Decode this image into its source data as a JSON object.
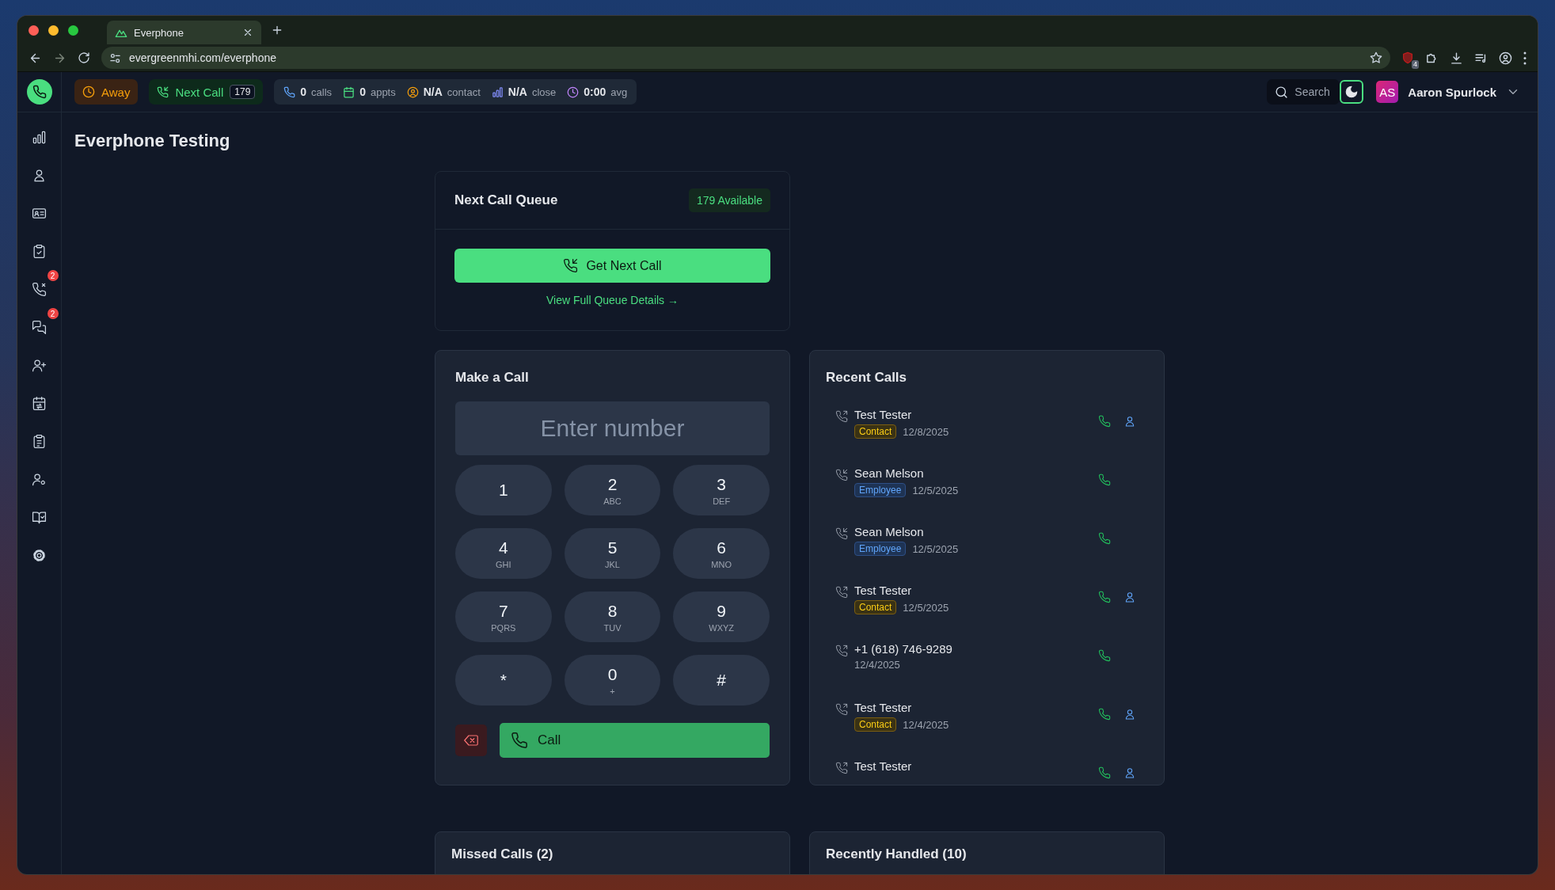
{
  "browser": {
    "tab_title": "Everphone",
    "url": "evergreenmhi.com/everphone",
    "extension_badge": "4"
  },
  "topbar": {
    "status": "Away",
    "next_call": {
      "label": "Next Call",
      "count": "179"
    },
    "stats": [
      {
        "kind": "calls",
        "value": "0",
        "label": "calls"
      },
      {
        "kind": "appts",
        "value": "0",
        "label": "appts"
      },
      {
        "kind": "contact",
        "value": "N/A",
        "label": "contact"
      },
      {
        "kind": "close",
        "value": "N/A",
        "label": "close"
      },
      {
        "kind": "avg",
        "value": "0:00",
        "label": "avg"
      }
    ],
    "search": {
      "placeholder": "Search"
    },
    "user": {
      "initials": "AS",
      "name": "Aaron Spurlock"
    }
  },
  "sidebar": {
    "items": [
      {
        "kind": "stats"
      },
      {
        "kind": "user"
      },
      {
        "kind": "card"
      },
      {
        "kind": "tasks"
      },
      {
        "kind": "missed",
        "badge": "2"
      },
      {
        "kind": "messages",
        "badge": "2"
      },
      {
        "kind": "add-user"
      },
      {
        "kind": "schedule"
      },
      {
        "kind": "list"
      },
      {
        "kind": "user-settings"
      },
      {
        "kind": "book"
      },
      {
        "kind": "settings"
      }
    ]
  },
  "page_title": "Everphone Testing",
  "queue": {
    "title": "Next Call Queue",
    "available": "179 Available",
    "button": "Get Next Call",
    "link": "View Full Queue Details →"
  },
  "dialer": {
    "title": "Make a Call",
    "placeholder": "Enter number",
    "keys": [
      {
        "digit": "1"
      },
      {
        "digit": "2",
        "letters": "ABC"
      },
      {
        "digit": "3",
        "letters": "DEF"
      },
      {
        "digit": "4",
        "letters": "GHI"
      },
      {
        "digit": "5",
        "letters": "JKL"
      },
      {
        "digit": "6",
        "letters": "MNO"
      },
      {
        "digit": "7",
        "letters": "PQRS"
      },
      {
        "digit": "8",
        "letters": "TUV"
      },
      {
        "digit": "9",
        "letters": "WXYZ"
      },
      {
        "digit": "*"
      },
      {
        "digit": "0",
        "letters": "+"
      },
      {
        "digit": "#"
      }
    ],
    "call_button": "Call"
  },
  "recent": {
    "title": "Recent Calls",
    "calls": [
      {
        "name": "Test Tester",
        "kind": "outgoing",
        "tag": {
          "label": "Contact",
          "kind": "contact"
        },
        "date": "12/8/2025",
        "profile": true
      },
      {
        "name": "Sean Melson",
        "kind": "incoming",
        "tag": {
          "label": "Employee",
          "kind": "employee"
        },
        "date": "12/5/2025",
        "profile": false
      },
      {
        "name": "Sean Melson",
        "kind": "incoming",
        "tag": {
          "label": "Employee",
          "kind": "employee"
        },
        "date": "12/5/2025",
        "profile": false
      },
      {
        "name": "Test Tester",
        "kind": "outgoing",
        "tag": {
          "label": "Contact",
          "kind": "contact"
        },
        "date": "12/5/2025",
        "profile": true
      },
      {
        "name": "+1 (618) 746-9289",
        "kind": "outgoing",
        "date": "12/4/2025",
        "profile": false
      },
      {
        "name": "Test Tester",
        "kind": "outgoing",
        "tag": {
          "label": "Contact",
          "kind": "contact"
        },
        "date": "12/4/2025",
        "profile": true
      },
      {
        "name": "Test Tester",
        "kind": "outgoing",
        "profile": true
      }
    ]
  },
  "panels": [
    {
      "title": "Missed Calls (2)"
    },
    {
      "title": "Recently Handled (10)"
    }
  ]
}
